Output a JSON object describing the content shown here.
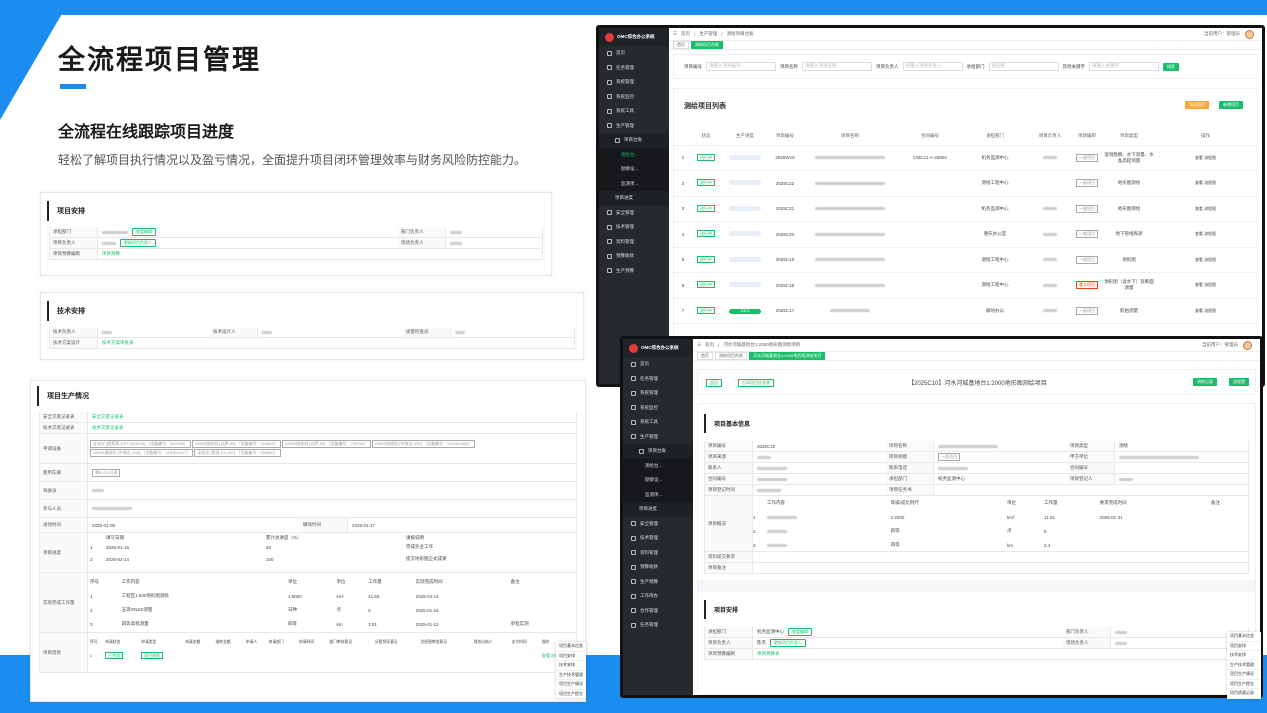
{
  "hero": {
    "title": "全流程项目管理",
    "subtitle": "全流程在线跟踪项目进度",
    "desc": "轻松了解项目执行情况以及盈亏情况，全面提升项目闭环管理效率与财务风险防控能力。"
  },
  "card1": {
    "title": "项目安排",
    "rows": [
      [
        "承担部门",
        "部门负责人"
      ],
      [
        "项目负责人",
        "现场负责人"
      ],
      [
        "项目预算编制",
        ""
      ]
    ],
    "budget_link": "项目预算",
    "tag1": "查看编辑",
    "tag2": "更换项目负责人"
  },
  "card2": {
    "title": "技术安排",
    "l1": "技术负责人",
    "l2": "技术设计人",
    "l3": "质量检查员",
    "l4": "技术方案设计",
    "link": "技术方案审批表"
  },
  "card3": {
    "title": "项目生产情况",
    "r1": "安全交底记录表",
    "r1v": "安全交底记录表",
    "r2": "技术交底记录表",
    "r2v": "技术交底记录表",
    "r3": "申请设备",
    "devices": [
      "全站仪 [图莱赛-GPT-3002LN] （设备编号：4K2085）",
      "GNSS接收机 [以萨-60] （设备编号：224880）",
      "GNSS接收机 [以萨-60] （设备编号：226756）",
      "GNSS接收机 [中海达-V90] （设备编号：VH1804300）",
      "GNSS接收机 [中海达-V90] （设备编号：VH1804417）",
      "全站仪 [索佳-FX-201] （设备编号：960880）"
    ],
    "r4": "使用车辆",
    "car": "粤B·G3 轩逸",
    "r5": "驾驶员",
    "r6": "参与人员",
    "r7": "进场时间",
    "r7v": "2025-01-09",
    "r7b": "撤场时间",
    "r7bv": "2025-01-17",
    "prog_h": [
      "填写日期",
      "累计总进度（%）",
      "填报说明"
    ],
    "prog": [
      [
        "1",
        "2025-01-15",
        "60",
        "完成外业工作"
      ],
      [
        "2",
        "2025-02-14",
        "100",
        "提交地形图正式成果"
      ]
    ],
    "r8": "项目进度",
    "r9": "实际完成工作量",
    "work_h": [
      "序号",
      "工作内容",
      "单位",
      "单位",
      "工作量",
      "实际完成时间",
      "备注"
    ],
    "work": [
      [
        "1",
        "工程区1:500地形图测绘",
        "1:5000",
        "km²",
        "41.55",
        "2025-02-14",
        ""
      ],
      [
        "2",
        "五等GNSS测量",
        "日种",
        "点",
        "6",
        "2025-01-15",
        ""
      ],
      [
        "3",
        "四等高程测量",
        "四等",
        "km",
        "3.01",
        "2025-01-12",
        "单程实测"
      ]
    ],
    "r10": "项目借款",
    "loan_h": [
      "序号",
      "申请状态",
      "申请类型",
      "申请金额",
      "借款金额",
      "申请人",
      "申请部门",
      "申请时间",
      "部门审核意见",
      "分管领导意见",
      "总经理审批意见",
      "财务出纳人",
      "支付时间",
      "操作"
    ],
    "loan_status": "已完成",
    "loan_type": "项目借款",
    "loan_op": "查看详情"
  },
  "shot1": {
    "app": "OMC综合办公系统",
    "bc1": "首页",
    "bc2": "生产管理",
    "bc3": "测绘项目台账",
    "user": "当前用户：管理员",
    "tab1": "首页",
    "tab2": "测绘项目台账",
    "f1": "项目编号",
    "f1p": "请输入项目编号",
    "f2": "项目名称",
    "f2p": "请输入项目名称",
    "f3": "项目负责人",
    "f3p": "请输入项目负责人",
    "f4": "承担部门",
    "f4p": "请选择",
    "f5": "其他关键字",
    "f5p": "请输入关键字",
    "search": "搜索",
    "list_title": "测绘项目列表",
    "export": "导出项目",
    "add": "新增项目",
    "cols": [
      "状态",
      "生产进度",
      "项目编号",
      "项目名称",
      "合同编号",
      "承担部门",
      "项目负责人",
      "项目编审",
      "项目类型",
      "操作"
    ],
    "menu": [
      "首页",
      "任务管理",
      "系统管理",
      "系统监控",
      "系统工具",
      "生产管理",
      "项目台账",
      "测绘台...",
      "勘察设...",
      "监测项...",
      "项目进度",
      "安全管理",
      "技术管理",
      "资料管理",
      "预算收款",
      "生产预算",
      "工作待办",
      "合作管理",
      "任务管理"
    ],
    "rows": [
      [
        "1",
        "进行中",
        "",
        "2025W15",
        "",
        "CMC21-A-25802",
        "机务监测中心",
        "",
        "一般项目",
        "溶洞勘察、水下测量、水准高程测量"
      ],
      [
        "2",
        "进行中",
        "",
        "2025C22",
        "",
        "",
        "测绘工程中心",
        "",
        "一般项目",
        "地形图测绘"
      ],
      [
        "3",
        "进行中",
        "",
        "2025C21",
        "",
        "",
        "机务监测中心",
        "",
        "一般项目",
        "地形图测绘"
      ],
      [
        "4",
        "进行中",
        "",
        "2025C20",
        "",
        "",
        "重庆办公室",
        "",
        "一般项目",
        "地下管线探测"
      ],
      [
        "5",
        "进行中",
        "",
        "2025C19",
        "",
        "",
        "测绘工程中心",
        "",
        "一般项目",
        "地形图"
      ],
      [
        "6",
        "进行中",
        "",
        "2025C18",
        "",
        "",
        "测绘工程中心",
        "",
        "重大项目",
        "地形图（含水下）及断面测量"
      ],
      [
        "7",
        "进行中",
        "100%",
        "2025C17",
        "",
        "",
        "廊坊办公",
        "",
        "一般项目",
        "航拍测量"
      ]
    ],
    "ops": [
      "查看",
      "流程图",
      "生成项目信息"
    ]
  },
  "shot2": {
    "app": "OMC综合办公系统",
    "bc1": "首页",
    "bc2": "河水河城基地台1:2000地形图测绘项目",
    "user": "当前用户：管理员",
    "tab1": "首页",
    "tab2": "测绘项目台账",
    "tab3": "河水河城基地台1:2000地形图测绘项目",
    "back": "返回",
    "download": "打印项目信息表",
    "proj_title": "【2025C10】河水河城基地台1:2000地形图测绘项目",
    "btn1": "流转记录",
    "btn2": "流程图",
    "sec1": "项目基本信息",
    "fields": [
      [
        "项目编号",
        "2025C10",
        "项目名称",
        "",
        "项目类型",
        "测绘"
      ],
      [
        "项目来源",
        "",
        "项目规模",
        "一般项目",
        "甲方单位",
        ""
      ],
      [
        "联系人",
        "",
        "联系电话",
        "",
        "合同编号",
        ""
      ],
      [
        "合同编号",
        "",
        "承担部门",
        "机务监测中心",
        "项目登记人",
        ""
      ],
      [
        "项目登记时间",
        "",
        "项目任务书",
        "",
        ""
      ]
    ],
    "work_title": "项目概况",
    "work_h": [
      "工作内容",
      "等级/成比例尺",
      "单位",
      "工作量",
      "要求完成时间",
      "备注"
    ],
    "work": [
      [
        "1",
        "",
        "1:2000",
        "km²",
        "11.51",
        "2025-01-31",
        ""
      ],
      [
        "2",
        "",
        "四等",
        "点",
        "6",
        "",
        ""
      ],
      [
        "3",
        "",
        "四等",
        "km",
        "2.4",
        "",
        ""
      ]
    ],
    "r_extra1": "资料提交要求",
    "r_extra2": "项目备注",
    "sec2": "项目安排",
    "a1": "承担部门",
    "a1v": "机务监测中心",
    "a1tag": "查看编辑",
    "a2": "部门负责人",
    "a3": "项目负责人",
    "a3v": "陈杰",
    "a3tag": "更换项目负责人",
    "a4": "现场负责人",
    "a5": "项目预算编制",
    "a5v": "项目预算表",
    "menu": [
      "首页",
      "任务管理",
      "系统管理",
      "系统监控",
      "系统工具",
      "生产管理",
      "项目台账",
      "测绘台...",
      "勘察设...",
      "监测项...",
      "项目进度",
      "安全管理",
      "技术管理",
      "资料管理",
      "预算收款",
      "生产预算",
      "工作待办",
      "合作管理",
      "任务管理"
    ]
  },
  "float1": [
    "项目基本信息",
    "项目安排",
    "技术安排",
    "生产技术管理",
    "项目生产情况",
    "项目生产提交",
    "项目质量记录"
  ],
  "float2": [
    "项目基本信息",
    "项目安排",
    "技术安排",
    "生产技术管理",
    "项目生产情况",
    "项目生产提交",
    "项目质量记录"
  ]
}
